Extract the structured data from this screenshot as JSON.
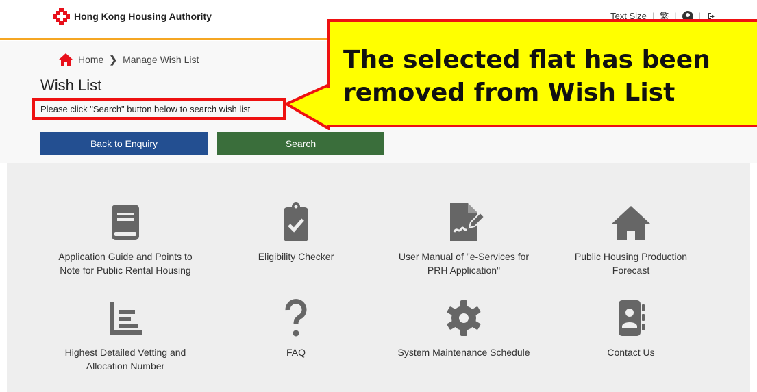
{
  "header": {
    "logo_text": "Hong Kong Housing Authority",
    "text_size_label": "Text Size",
    "lang_label": "繁"
  },
  "breadcrumb": {
    "home": "Home",
    "current": "Manage Wish List"
  },
  "page": {
    "title": "Wish List",
    "instruction": "Please click \"Search\" button below to search wish list"
  },
  "buttons": {
    "back": "Back to Enquiry",
    "search": "Search"
  },
  "callout": {
    "line1": "The selected flat has been",
    "line2": "removed from Wish List"
  },
  "services": [
    {
      "icon": "book-icon",
      "label_1": "Application Guide and Points to",
      "label_2": "Note for Public Rental Housing"
    },
    {
      "icon": "clipboard-check-icon",
      "label_1": "Eligibility Checker",
      "label_2": ""
    },
    {
      "icon": "signature-document-icon",
      "label_1": "User Manual of \"e-Services for",
      "label_2": "PRH Application\""
    },
    {
      "icon": "home-icon",
      "label_1": "Public Housing Production",
      "label_2": "Forecast"
    },
    {
      "icon": "list-chart-icon",
      "label_1": "Highest Detailed Vetting and",
      "label_2": "Allocation Number"
    },
    {
      "icon": "question-icon",
      "label_1": "FAQ",
      "label_2": ""
    },
    {
      "icon": "gear-icon",
      "label_1": "System Maintenance Schedule",
      "label_2": ""
    },
    {
      "icon": "contact-book-icon",
      "label_1": "Contact Us",
      "label_2": ""
    }
  ],
  "colors": {
    "accent": "#f5a623",
    "back_button": "#234f91",
    "search_button": "#3a6e3b",
    "callout_bg": "#ffff00",
    "highlight": "#ee1111",
    "icon_gray": "#666666",
    "home_red": "#e8101b"
  }
}
